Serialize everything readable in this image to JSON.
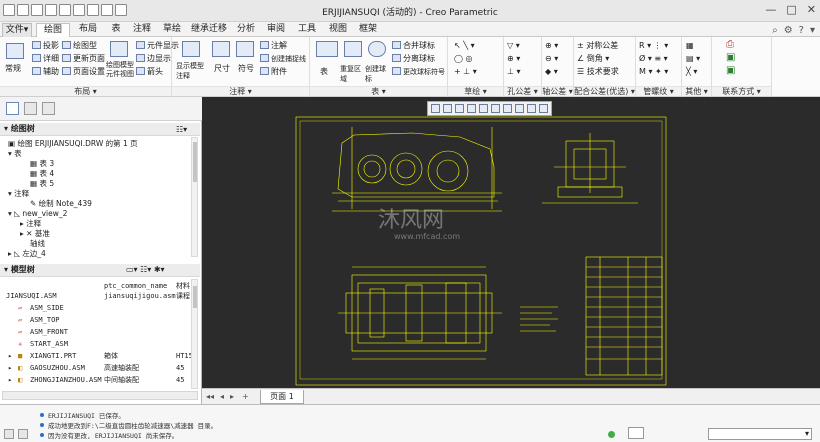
{
  "window": {
    "title": "ERJIJIANSUQI (活动的) - Creo Parametric"
  },
  "tabs": [
    {
      "label": "文件",
      "kind": "file"
    },
    {
      "label": "绘图",
      "kind": "active"
    },
    {
      "label": "布局"
    },
    {
      "label": "表"
    },
    {
      "label": "注释"
    },
    {
      "label": "草绘"
    },
    {
      "label": "继承迁移"
    },
    {
      "label": "分析"
    },
    {
      "label": "审阅"
    },
    {
      "label": "工具"
    },
    {
      "label": "视图"
    },
    {
      "label": "框架"
    }
  ],
  "ribbon": {
    "group_labels": [
      "布局",
      "注释",
      "表",
      "草绘",
      "孔公差",
      "轴公差",
      "配合公差(优选)",
      "管螺纹",
      "其他",
      "联系方式"
    ],
    "layout": {
      "big": "常规",
      "items": [
        "投影",
        "详细",
        "辅助",
        "绘图型",
        "更新页面",
        "页面设置",
        "元件显示",
        "边显示",
        "箭头"
      ],
      "big2a": "绘图模型",
      "big2b": "元件视图"
    },
    "annotation": {
      "big1": "显示模型注释",
      "big2": "尺寸",
      "big3": "符号",
      "items": [
        "注解",
        "创建捕捉线",
        "附件"
      ]
    },
    "table": {
      "big1": "表",
      "big2": "重复区域",
      "big3": "创建球标",
      "items": [
        "合并球标",
        "分离球标",
        "更改球标符号"
      ]
    },
    "tol": {
      "items": [
        "对称公差",
        "倒角",
        "技术要求"
      ]
    }
  },
  "left_panel": {
    "draw_tree": {
      "header": "绘图树",
      "items": [
        "绘图 ERJIJIANSUQI.DRW 的第 1 页",
        "表",
        "表 3",
        "表 4",
        "表 5",
        "注释",
        "绘制 Note_439",
        "new_view_2",
        "注释",
        "基准",
        "轴线",
        "左边_4"
      ]
    },
    "model_tree": {
      "header": "模型树",
      "col1": "ptc_common_name",
      "col2": "材料",
      "rows": [
        {
          "name": "JIANSUQI.ASM",
          "common": "jiansuqijigou.asm",
          "mat": "课程"
        },
        {
          "name": "ASM_SIDE",
          "common": "",
          "mat": ""
        },
        {
          "name": "ASM_TOP",
          "common": "",
          "mat": ""
        },
        {
          "name": "ASM_FRONT",
          "common": "",
          "mat": ""
        },
        {
          "name": "START_ASM",
          "common": "",
          "mat": ""
        },
        {
          "name": "XIANGTI.PRT",
          "common": "箱体",
          "mat": "HT15"
        },
        {
          "name": "GAOSUZHOU.ASM",
          "common": "高速轴装配",
          "mat": "45"
        },
        {
          "name": "ZHONGJIANZHOU.ASM",
          "common": "中间轴装配",
          "mat": "45"
        }
      ]
    }
  },
  "sheet": {
    "page_label": "页面 1"
  },
  "status": {
    "messages": [
      "ERJIJIANSUQI 已保存。",
      "成功地更改到F:\\二级直齿圆柱齿轮减速器\\减速器 目录。",
      "因为没有更改, ERJIJIANSUQI 尚未保存。"
    ]
  },
  "watermark": {
    "text": "沐风网",
    "sub": "www.mfcad.com"
  },
  "colors": {
    "canvas": "#2b2b2b",
    "drawing": "#ffff00",
    "accent": "#2a6fd0"
  }
}
